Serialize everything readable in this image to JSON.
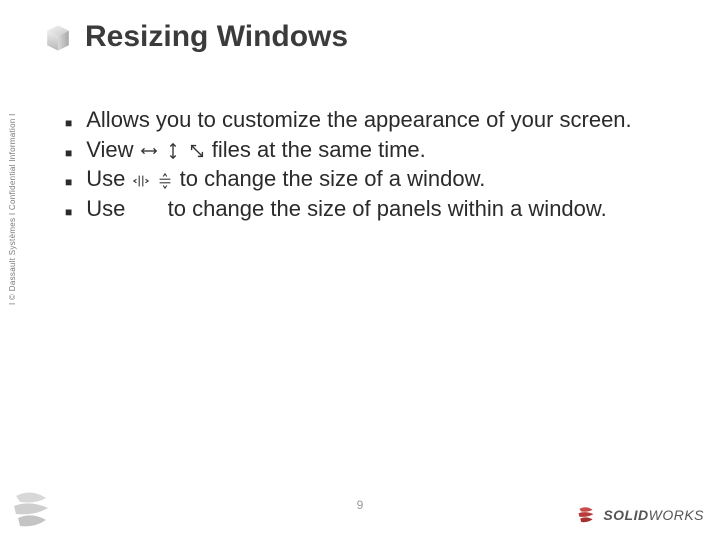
{
  "title": "Resizing Windows",
  "sidebar": "Ι © Dassault Systèmes Ι Confidential Information Ι",
  "bullets": [
    {
      "pre": "Allows you to customize the appearance of your screen.",
      "post": ""
    },
    {
      "pre": "View",
      "post": " files at the same time.",
      "icons": [
        "h",
        "v",
        "d"
      ]
    },
    {
      "pre": "Use ",
      "post": " to change the size of a window.",
      "icons": [
        "split-h",
        "split-v"
      ]
    },
    {
      "pre": "Use ",
      "post": " to change the size of panels within a window.",
      "icons": []
    }
  ],
  "page_number": "9",
  "logos": {
    "ds_alt": "Dassault Systèmes",
    "sw_text_a": "SOLID",
    "sw_text_b": "WORKS"
  }
}
